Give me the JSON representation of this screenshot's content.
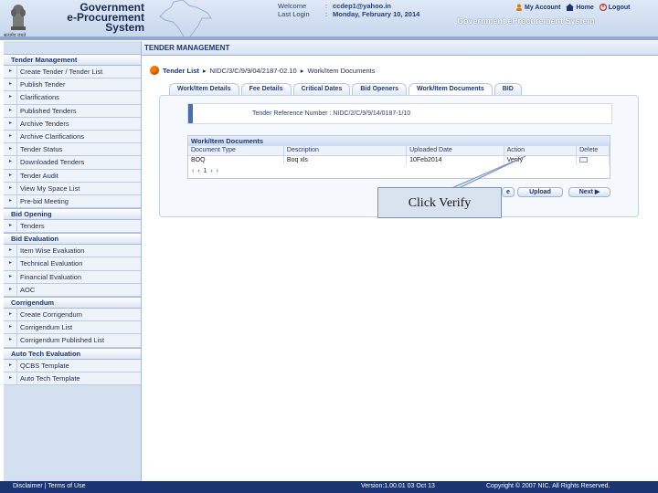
{
  "header": {
    "logo_lines": [
      "Government",
      "e-Procurement",
      "System"
    ],
    "emblem_caption": "सत्यमेव जयते",
    "welcome_label": "Welcome",
    "welcome_value": "ccdep1@yahoo.in",
    "last_login_label": "Last Login",
    "last_login_value": "Monday, February 10, 2014",
    "colon": ":",
    "links": {
      "my_account": "My Account",
      "home": "Home",
      "logout": "Logout"
    },
    "system_title": "Government eProcurement System"
  },
  "section_title": "TENDER MANAGEMENT",
  "sidebar": {
    "groups": [
      {
        "title": "Tender Management",
        "items": [
          "Create Tender / Tender List",
          "Publish Tender",
          "Clarifications",
          "Published Tenders",
          "Archive Tenders",
          "Archive Clarifications",
          "Tender Status",
          "Downloaded Tenders",
          "Tender Audit",
          "View My Space List",
          "Pre-bid Meeting"
        ]
      },
      {
        "title": "Bid Opening",
        "items": [
          "Tenders"
        ]
      },
      {
        "title": "Bid Evaluation",
        "items": [
          "Item Wise Evaluation",
          "Technical Evaluation",
          "Financial Evaluation",
          "AOC"
        ]
      },
      {
        "title": "Corrigendum",
        "items": [
          "Create Corrigendum",
          "Corrigendum List",
          "Corrigendum Published List"
        ]
      },
      {
        "title": "Auto Tech Evaluation",
        "items": [
          "QCBS Template",
          "Auto Tech Template"
        ]
      }
    ]
  },
  "breadcrumb": {
    "root": "Tender List",
    "sep": "▸",
    "tender_id": "NIDC/3/C/9/9/04/2187-02.10",
    "current": "Work/Item Documents"
  },
  "tabs": [
    "Work/Item Details",
    "Fee Details",
    "Critical Dates",
    "Bid Openers",
    "Work/Item Documents",
    "BID"
  ],
  "tender_ref": {
    "label": "Tender Reference Number :",
    "value": "NIDC/2/C/9/9/14/0187-1/10"
  },
  "work_item_docs": {
    "title": "Work/Item Documents",
    "columns": [
      "Document Type",
      "Description",
      "Uploaded Date",
      "Action",
      "Delete"
    ],
    "rows": [
      {
        "type": "BOQ",
        "description": "Boq xls",
        "date": "10Feb2014",
        "action": "Verify"
      }
    ],
    "pager": "‹ ‹ 1 › ›"
  },
  "buttons": {
    "partial": "e",
    "upload": "Upload",
    "next": "Next ▶"
  },
  "callout": "Click Verify",
  "footer": {
    "left": "Disclaimer | Terms of Use",
    "version": "Version:1.00.01 03 Oct 13",
    "copyright": "Copyright © 2007 NIC. All Rights Reserved."
  },
  "colors": {
    "brand_dark": "#1b3473",
    "accent_orange": "#f07c00"
  },
  "icons": [
    "emblem-icon",
    "india-map-icon",
    "user-icon",
    "home-icon",
    "logout-icon",
    "arrow-right-icon",
    "delete-doc-icon"
  ]
}
